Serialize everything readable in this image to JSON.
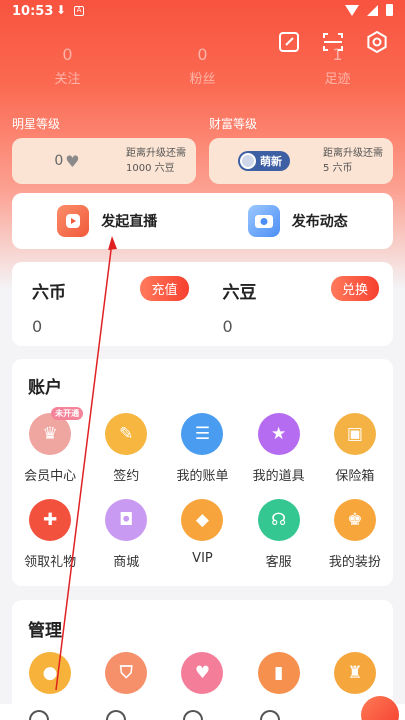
{
  "status_bar": {
    "time": "10:53",
    "download_icon": "download-icon",
    "a_badge": "A"
  },
  "top_icons": [
    "edit-icon",
    "scan-icon",
    "settings-icon"
  ],
  "stats": [
    {
      "value": "0",
      "label": "关注"
    },
    {
      "value": "0",
      "label": "粉丝"
    },
    {
      "value": "1",
      "label": "足迹"
    }
  ],
  "levels": {
    "star": {
      "title": "明星等级",
      "value": "0",
      "hint_line1": "距离升级还需",
      "hint_line2": "1000 六豆"
    },
    "wealth": {
      "title": "财富等级",
      "badge": "萌新",
      "hint_line1": "距离升级还需",
      "hint_line2": "5 六币"
    }
  },
  "actions": {
    "start_live": "发起直播",
    "post_update": "发布动态"
  },
  "money": {
    "coin": {
      "name": "六币",
      "value": "0",
      "button": "充值"
    },
    "bean": {
      "name": "六豆",
      "value": "0",
      "button": "兑换"
    }
  },
  "account": {
    "title": "账户",
    "not_opened_tag": "未开通",
    "items": [
      {
        "label": "会员中心",
        "icon": "crown-icon",
        "color": "#f0a6a0"
      },
      {
        "label": "签约",
        "icon": "contract-icon",
        "color": "#f6b640"
      },
      {
        "label": "我的账单",
        "icon": "bill-icon",
        "color": "#4a9cf0"
      },
      {
        "label": "我的道具",
        "icon": "star-prop-icon",
        "color": "#b56cf0"
      },
      {
        "label": "保险箱",
        "icon": "safe-icon",
        "color": "#f5b244"
      },
      {
        "label": "领取礼物",
        "icon": "gift-icon",
        "color": "#f1513d"
      },
      {
        "label": "商城",
        "icon": "shop-bag-icon",
        "color": "#c99af2"
      },
      {
        "label": "VIP",
        "icon": "vip-icon",
        "color": "#f7a43c"
      },
      {
        "label": "客服",
        "icon": "headset-icon",
        "color": "#34c792"
      },
      {
        "label": "我的装扮",
        "icon": "outfit-icon",
        "color": "#f7a63c"
      }
    ]
  },
  "manage": {
    "title": "管理",
    "items": [
      {
        "icon": "user-icon",
        "color": "#f7b23c"
      },
      {
        "icon": "shield-icon",
        "color": "#f5906a"
      },
      {
        "icon": "heart-icon",
        "color": "#f47e9a"
      },
      {
        "icon": "chart-icon",
        "color": "#f5904e"
      },
      {
        "icon": "trophy-icon",
        "color": "#f5a63c"
      }
    ]
  },
  "colors": {
    "brand": "#f8533f",
    "card_bg": "#ffffff",
    "page_bg": "#f4f4f6"
  }
}
